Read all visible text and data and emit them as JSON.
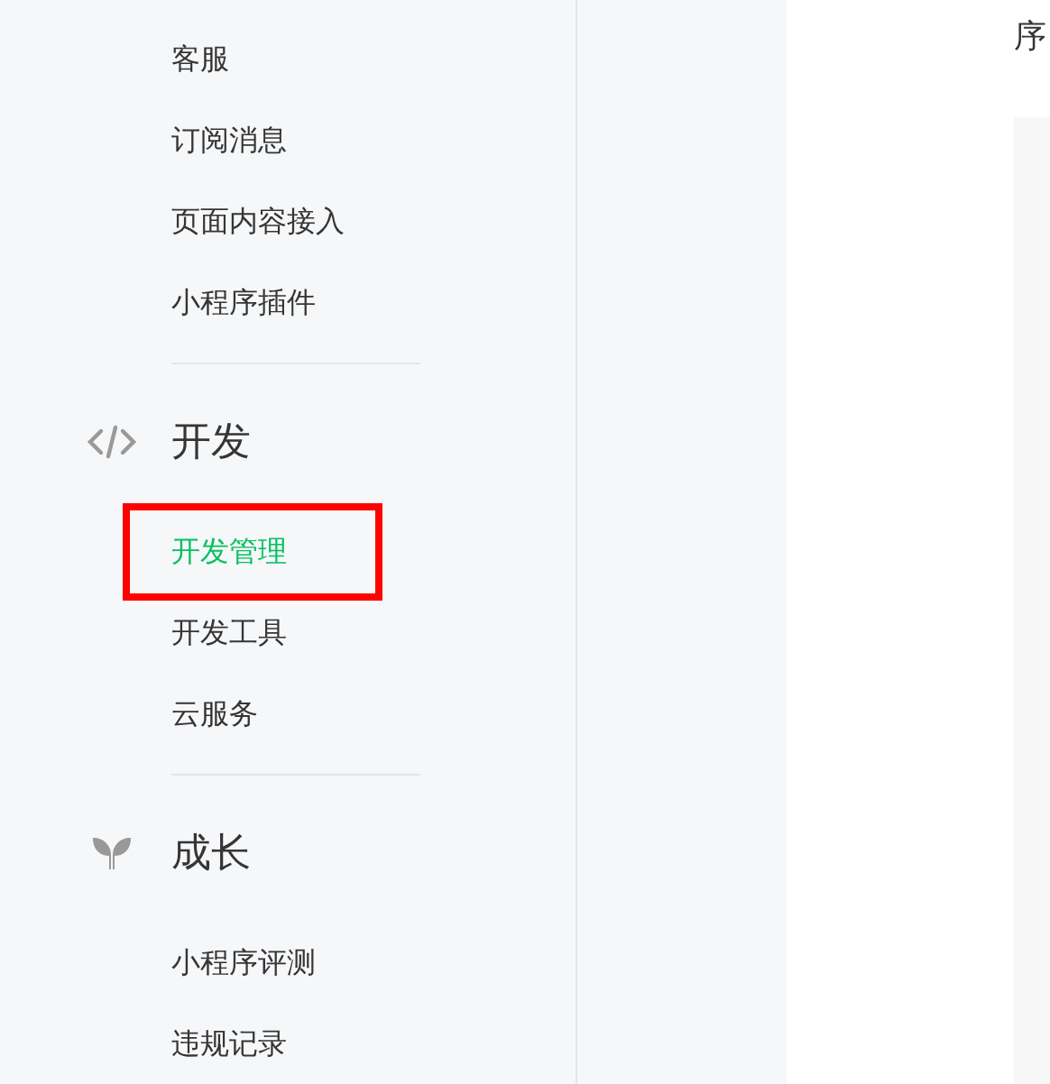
{
  "sidebar": {
    "groups": [
      {
        "items": [
          {
            "label": "客服",
            "selected": false,
            "highlighted": false
          },
          {
            "label": "订阅消息",
            "selected": false,
            "highlighted": false
          },
          {
            "label": "页面内容接入",
            "selected": false,
            "highlighted": false
          },
          {
            "label": "小程序插件",
            "selected": false,
            "highlighted": false
          }
        ]
      },
      {
        "title": "开发",
        "kind": "code",
        "items": [
          {
            "label": "开发管理",
            "selected": true,
            "highlighted": true
          },
          {
            "label": "开发工具",
            "selected": false,
            "highlighted": false
          },
          {
            "label": "云服务",
            "selected": false,
            "highlighted": false
          }
        ]
      },
      {
        "title": "成长",
        "kind": "sprout",
        "items": [
          {
            "label": "小程序评测",
            "selected": false,
            "highlighted": false
          },
          {
            "label": "违规记录",
            "selected": false,
            "highlighted": false
          }
        ]
      }
    ]
  },
  "content": {
    "title": "序"
  }
}
